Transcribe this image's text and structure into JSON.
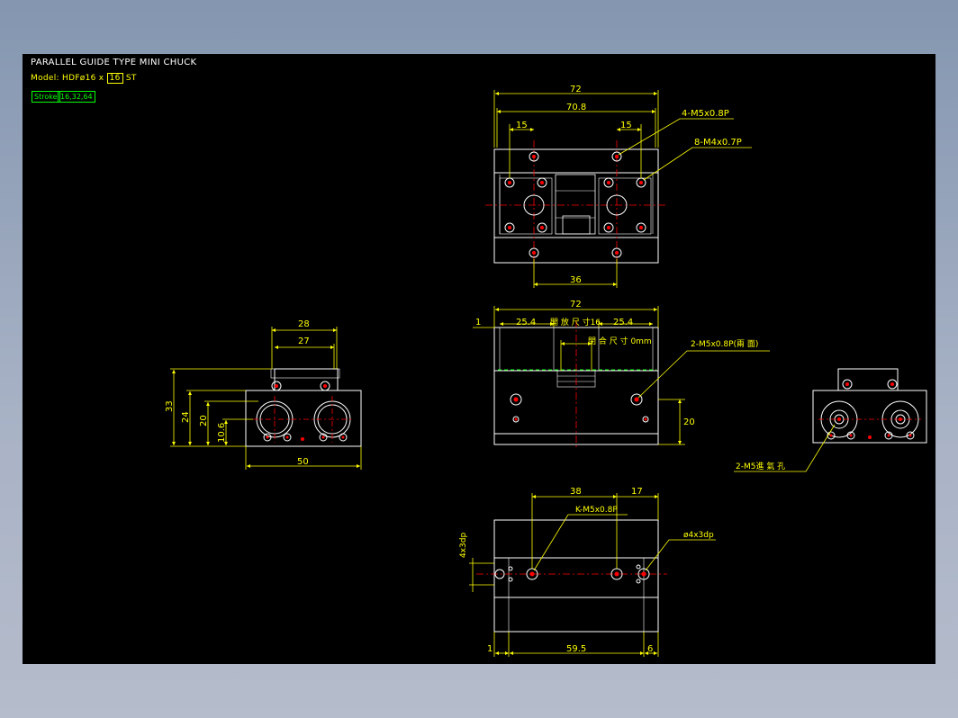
{
  "header": {
    "title": "PARALLEL GUIDE TYPE MINI CHUCK",
    "model_prefix": "Model: HDFø16 x",
    "model_box": "16",
    "model_suffix": "ST",
    "stroke_label": "Stroke",
    "stroke_value": "16,32,64"
  },
  "top_view": {
    "dim_72": "72",
    "dim_70_8": "70.8",
    "dim_15_left": "15",
    "dim_15_right": "15",
    "dim_36": "36",
    "note_m5": "4-M5x0.8P",
    "note_m4": "8-M4x0.7P"
  },
  "front_view": {
    "dim_72": "72",
    "dim_1": "1",
    "dim_25_4_left": "25.4",
    "open_label": "開 放 尺 寸16",
    "dim_25_4_right": "25.4",
    "close_label": "閉 合 尺 寸 0mm",
    "note_m5": "2-M5x0.8P(兩 面)",
    "dim_20": "20"
  },
  "side_view": {
    "dim_28": "28",
    "dim_27": "27",
    "dim_33": "33",
    "dim_24": "24",
    "dim_20": "20",
    "dim_10_6": "10.6",
    "dim_50": "50"
  },
  "right_view": {
    "note_m5": "2-M5進 氣 孔"
  },
  "bottom_view": {
    "dim_38": "38",
    "dim_17": "17",
    "note_k": "K-M5x0.8P",
    "note_dowel": "ø4x3dp",
    "dim_4x3dp": "4x3dp",
    "dim_1": "1",
    "dim_59_5": "59.5",
    "dim_6": "6"
  },
  "colors": {
    "outline": "#ffffff",
    "dimension": "#ffff00",
    "center": "#ff0000",
    "accent": "#00ff00"
  }
}
